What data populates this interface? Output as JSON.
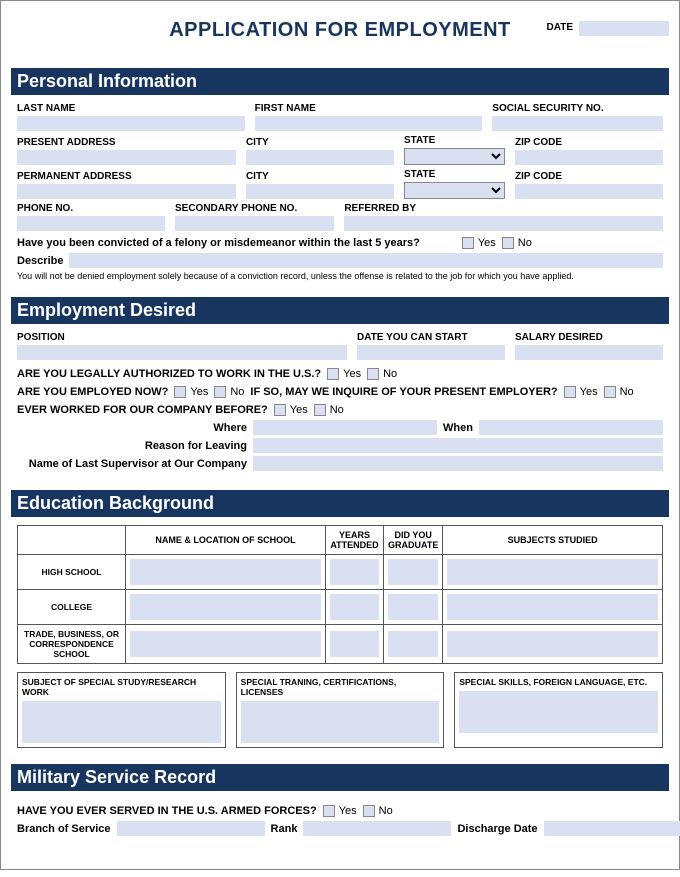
{
  "header": {
    "title": "APPLICATION FOR EMPLOYMENT",
    "date_label": "DATE"
  },
  "yes": "Yes",
  "no": "No",
  "personal": {
    "header": "Personal Information",
    "last_name": "LAST NAME",
    "first_name": "FIRST NAME",
    "ssn": "SOCIAL SECURITY NO.",
    "present_address": "PRESENT ADDRESS",
    "city": "CITY",
    "state": "STATE",
    "zip": "ZIP CODE",
    "permanent_address": "PERMANENT ADDRESS",
    "phone": "PHONE NO.",
    "sec_phone": "SECONDARY PHONE NO.",
    "referred_by": "REFERRED BY",
    "felony_q": "Have you been convicted of a felony or misdemeanor within the last 5 years?",
    "describe": "Describe",
    "disclaimer": "You will not be denied employment solely because of a conviction record, unless the offense is related to the job for which you have applied."
  },
  "employment": {
    "header": "Employment Desired",
    "position": "POSITION",
    "start_date": "DATE YOU CAN START",
    "salary": "SALARY DESIRED",
    "authorized_q": "ARE YOU LEGALLY AUTHORIZED TO WORK IN THE U.S.?",
    "employed_q": "ARE YOU EMPLOYED NOW?",
    "inquire_q": "IF SO, MAY WE INQUIRE OF YOUR PRESENT EMPLOYER?",
    "worked_before_q": "EVER WORKED FOR OUR COMPANY BEFORE?",
    "where": "Where",
    "when": "When",
    "reason": "Reason for Leaving",
    "supervisor": "Name of Last Supervisor at Our Company"
  },
  "education": {
    "header": "Education Background",
    "col_name": "NAME & LOCATION OF SCHOOL",
    "col_years": "YEARS ATTENDED",
    "col_grad": "DID YOU GRADUATE",
    "col_subjects": "SUBJECTS STUDIED",
    "row_hs": "HIGH SCHOOL",
    "row_college": "COLLEGE",
    "row_trade": "TRADE, BUSINESS, OR CORRESPONDENCE SCHOOL",
    "box1": "SUBJECT OF SPECIAL STUDY/RESEARCH WORK",
    "box2": "SPECIAL TRANING, CERTIFICATIONS, LICENSES",
    "box3": "SPECIAL SKILLS, FOREIGN LANGUAGE, ETC."
  },
  "military": {
    "header": "Military Service Record",
    "served_q": "HAVE YOU EVER SERVED IN THE U.S. ARMED FORCES?",
    "branch": "Branch of Service",
    "rank": "Rank",
    "discharge": "Discharge Date"
  }
}
